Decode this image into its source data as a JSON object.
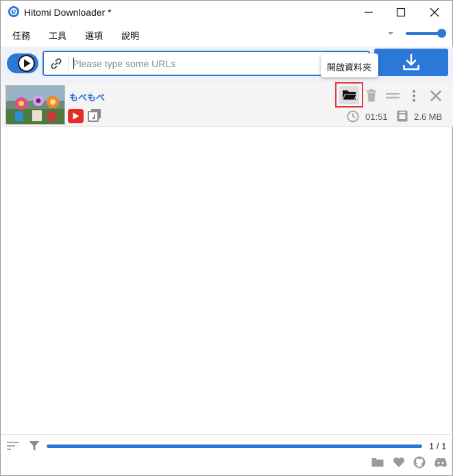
{
  "window": {
    "title": "Hitomi Downloader *",
    "minimize_icon": "minimize-icon",
    "maximize_icon": "maximize-icon",
    "close_icon": "close-icon"
  },
  "menu": {
    "items": [
      "任務",
      "工具",
      "選項",
      "說明"
    ]
  },
  "volume": {
    "level": 1.0
  },
  "url_bar": {
    "placeholder": "Please type some URLs",
    "value": ""
  },
  "tooltip": {
    "text": "開啟資料夾"
  },
  "task": {
    "title": "もべもべ",
    "site_icon": "youtube-icon",
    "type_icon": "media-icon",
    "duration": "01:51",
    "size": "2.6 MB",
    "actions": [
      "open-folder-icon",
      "delete-icon",
      "drag-handle-icon",
      "more-icon",
      "close-icon"
    ]
  },
  "footer": {
    "progress": 1.0,
    "page": "1 / 1",
    "links": [
      "folder-icon",
      "heart-icon",
      "github-icon",
      "discord-icon"
    ]
  },
  "colors": {
    "accent": "#2b78d8",
    "highlight_border": "#e53935",
    "link_text": "#2b6fd6"
  }
}
